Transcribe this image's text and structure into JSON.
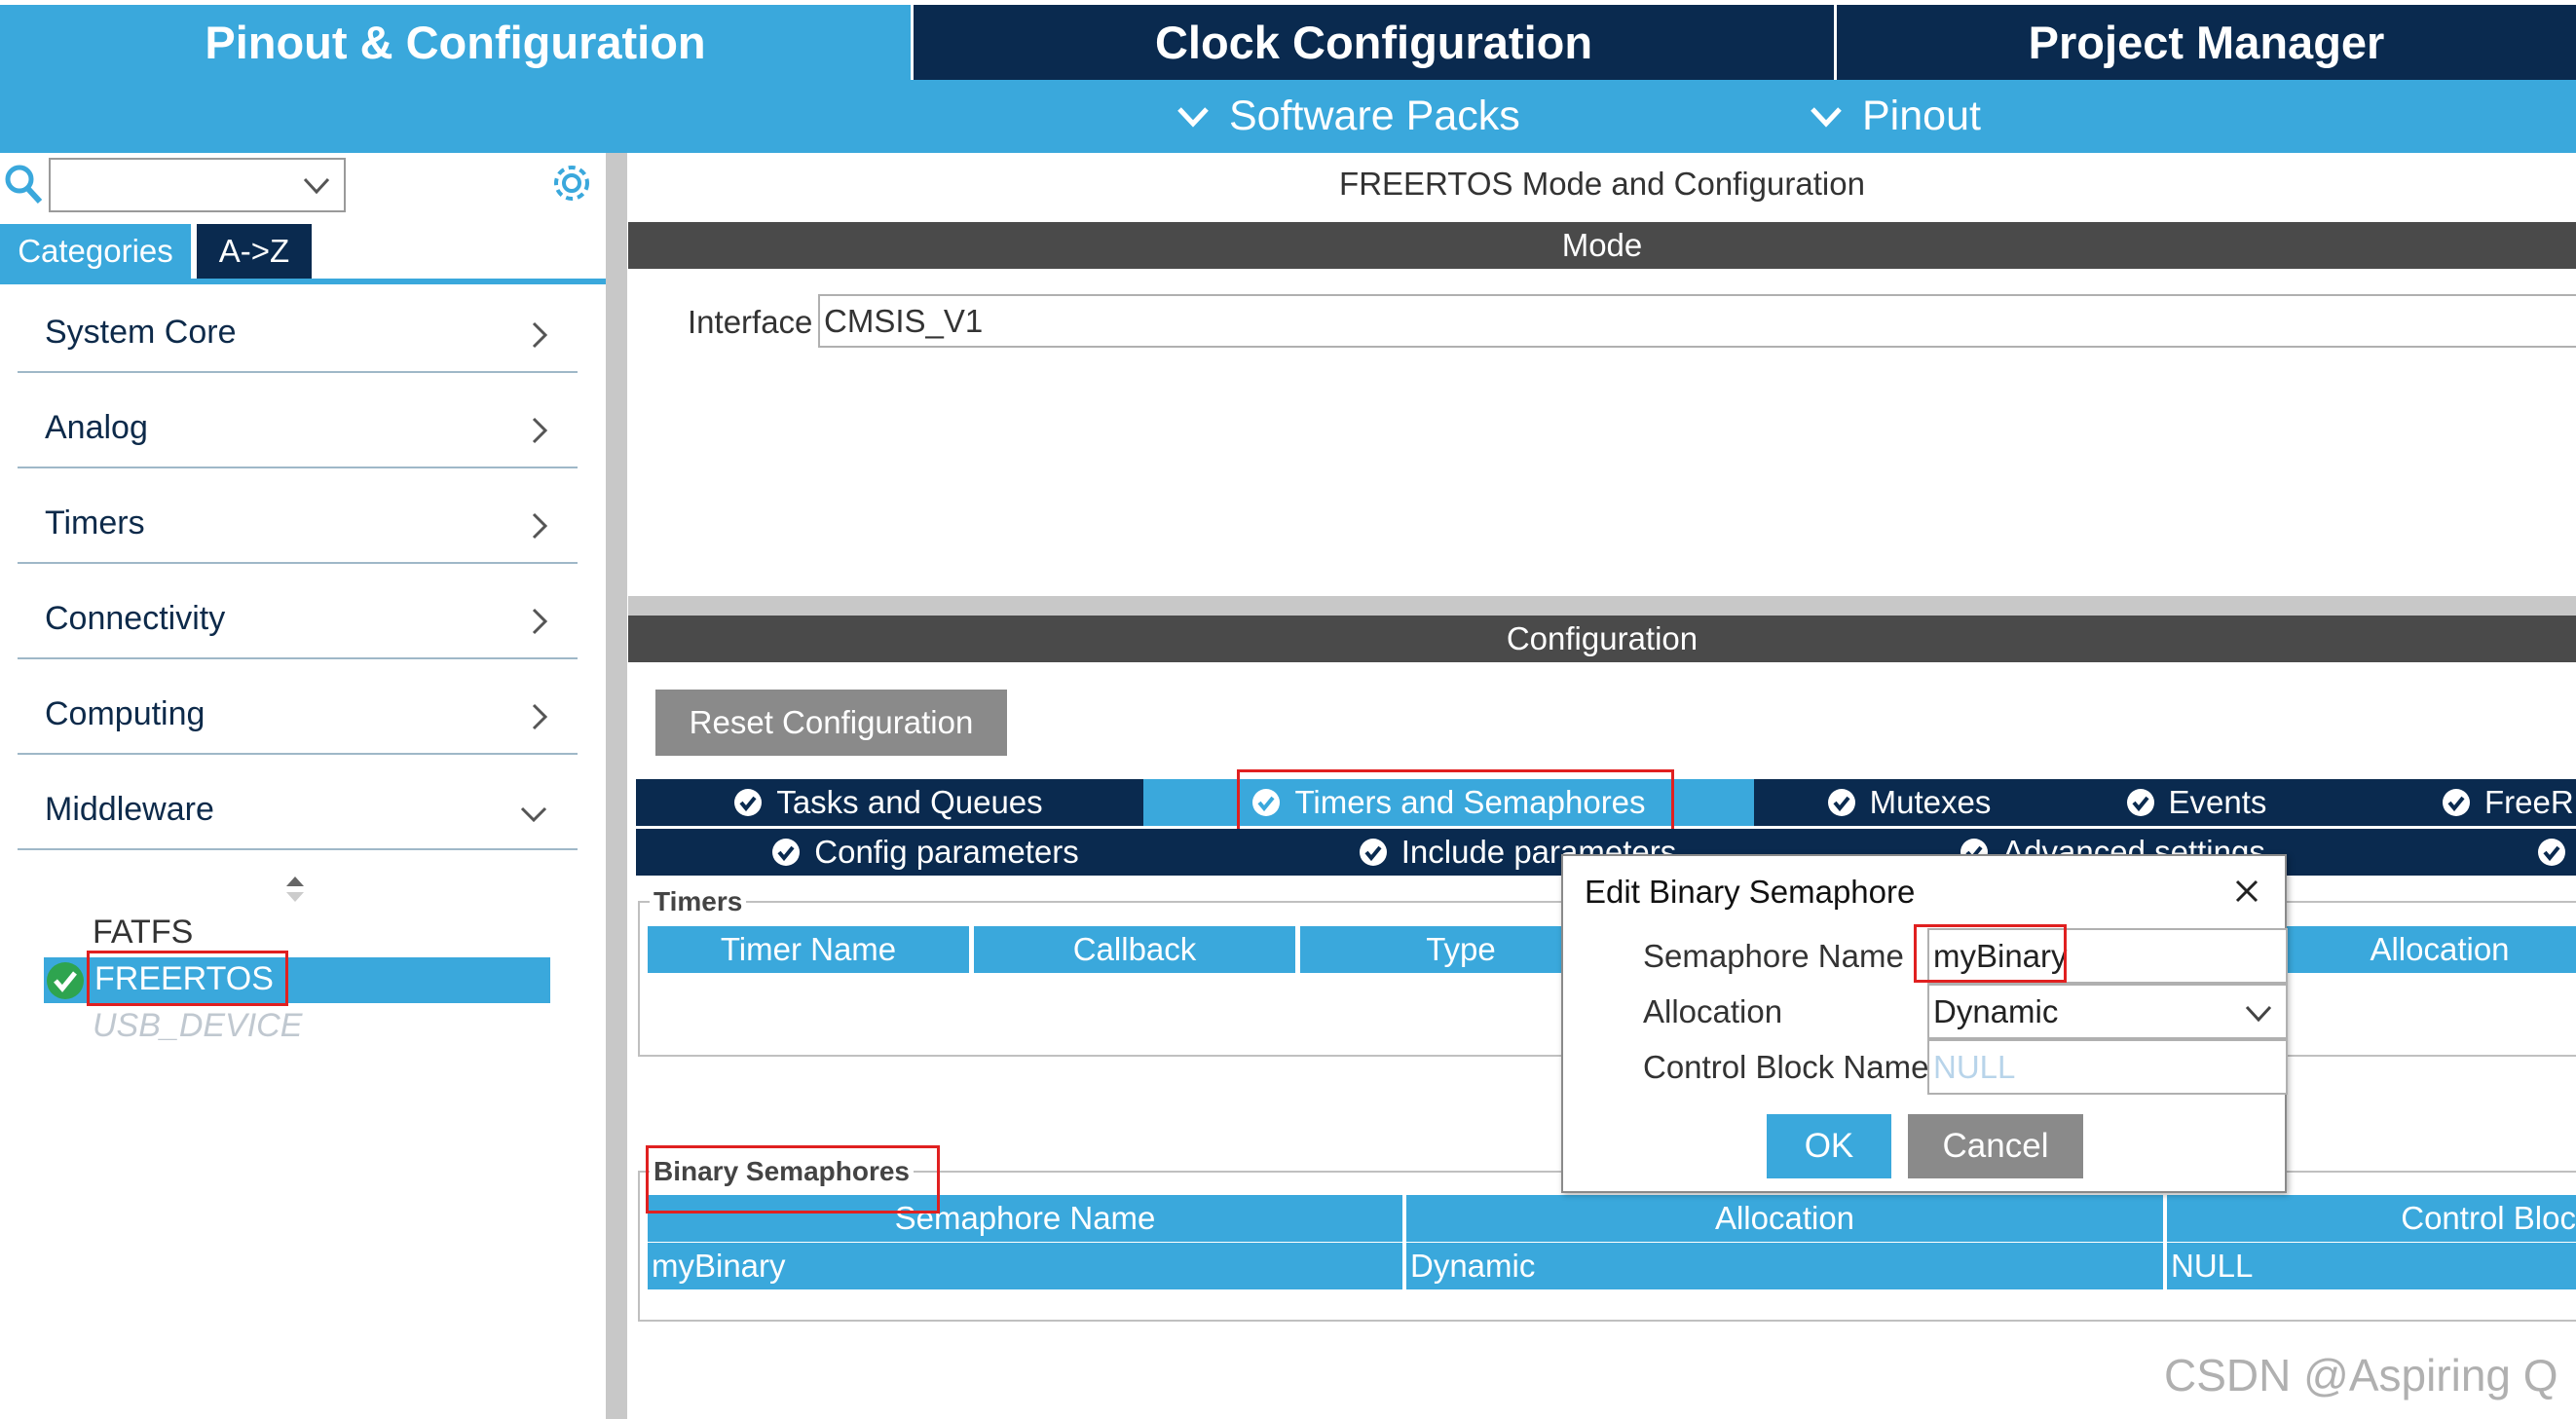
{
  "top_tabs": {
    "pinout": "Pinout & Configuration",
    "clock": "Clock Configuration",
    "project": "Project Manager"
  },
  "sub_menu": {
    "software_packs": "Software Packs",
    "pinout": "Pinout"
  },
  "left_panel": {
    "search_value": "",
    "tab_categories": "Categories",
    "tab_az": "A->Z",
    "categories": [
      {
        "label": "System Core"
      },
      {
        "label": "Analog"
      },
      {
        "label": "Timers"
      },
      {
        "label": "Connectivity"
      },
      {
        "label": "Computing"
      },
      {
        "label": "Middleware"
      }
    ],
    "middleware_items": {
      "fatfs": "FATFS",
      "freertos": "FREERTOS",
      "usb_device": "USB_DEVICE"
    }
  },
  "main": {
    "title": "FREERTOS Mode and Configuration",
    "mode_header": "Mode",
    "interface_label": "Interface",
    "interface_value": "CMSIS_V1",
    "config_header": "Configuration",
    "reset_button": "Reset Configuration",
    "tabs_row1": [
      "Tasks and Queues",
      "Timers and Semaphores",
      "Mutexes",
      "Events",
      "FreeR"
    ],
    "tabs_row2": [
      "Config parameters",
      "Include parameters",
      "Advanced settings"
    ],
    "timers": {
      "legend": "Timers",
      "columns": [
        "Timer Name",
        "Callback",
        "Type",
        "Allocation"
      ]
    },
    "binary_semaphores": {
      "legend": "Binary Semaphores",
      "columns": [
        "Semaphore Name",
        "Allocation",
        "Control Bloc"
      ],
      "rows": [
        {
          "name": "myBinary",
          "allocation": "Dynamic",
          "control": "NULL"
        }
      ]
    }
  },
  "dialog": {
    "title": "Edit Binary Semaphore",
    "name_label": "Semaphore Name",
    "name_value": "myBinary",
    "allocation_label": "Allocation",
    "allocation_value": "Dynamic",
    "control_label": "Control Block Name",
    "control_placeholder": "NULL",
    "ok": "OK",
    "cancel": "Cancel"
  },
  "watermark": "CSDN @Aspiring Q",
  "colors": {
    "navy": "#0a2a4f",
    "blue": "#3aa8dc",
    "dark_gray": "#4a4a4a",
    "highlight_red": "#e02020",
    "check_green": "#2ea44f"
  }
}
